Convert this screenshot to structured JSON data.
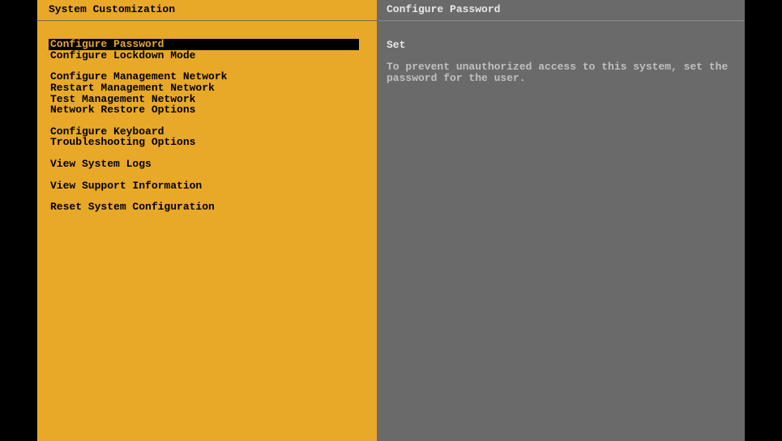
{
  "left": {
    "title": "System Customization",
    "groups": [
      [
        {
          "label": "Configure Password",
          "selected": true
        },
        {
          "label": "Configure Lockdown Mode",
          "selected": false
        }
      ],
      [
        {
          "label": "Configure Management Network",
          "selected": false
        },
        {
          "label": "Restart Management Network",
          "selected": false
        },
        {
          "label": "Test Management Network",
          "selected": false
        },
        {
          "label": "Network Restore Options",
          "selected": false
        }
      ],
      [
        {
          "label": "Configure Keyboard",
          "selected": false
        },
        {
          "label": "Troubleshooting Options",
          "selected": false
        }
      ],
      [
        {
          "label": "View System Logs",
          "selected": false
        }
      ],
      [
        {
          "label": "View Support Information",
          "selected": false
        }
      ],
      [
        {
          "label": "Reset System Configuration",
          "selected": false
        }
      ]
    ]
  },
  "right": {
    "title": "Configure Password",
    "status": "Set",
    "description": "To prevent unauthorized access to this system, set the password for the user."
  },
  "colors": {
    "accent": "#e8a828",
    "dark_panel": "#6a6a6a",
    "background": "#000000"
  }
}
